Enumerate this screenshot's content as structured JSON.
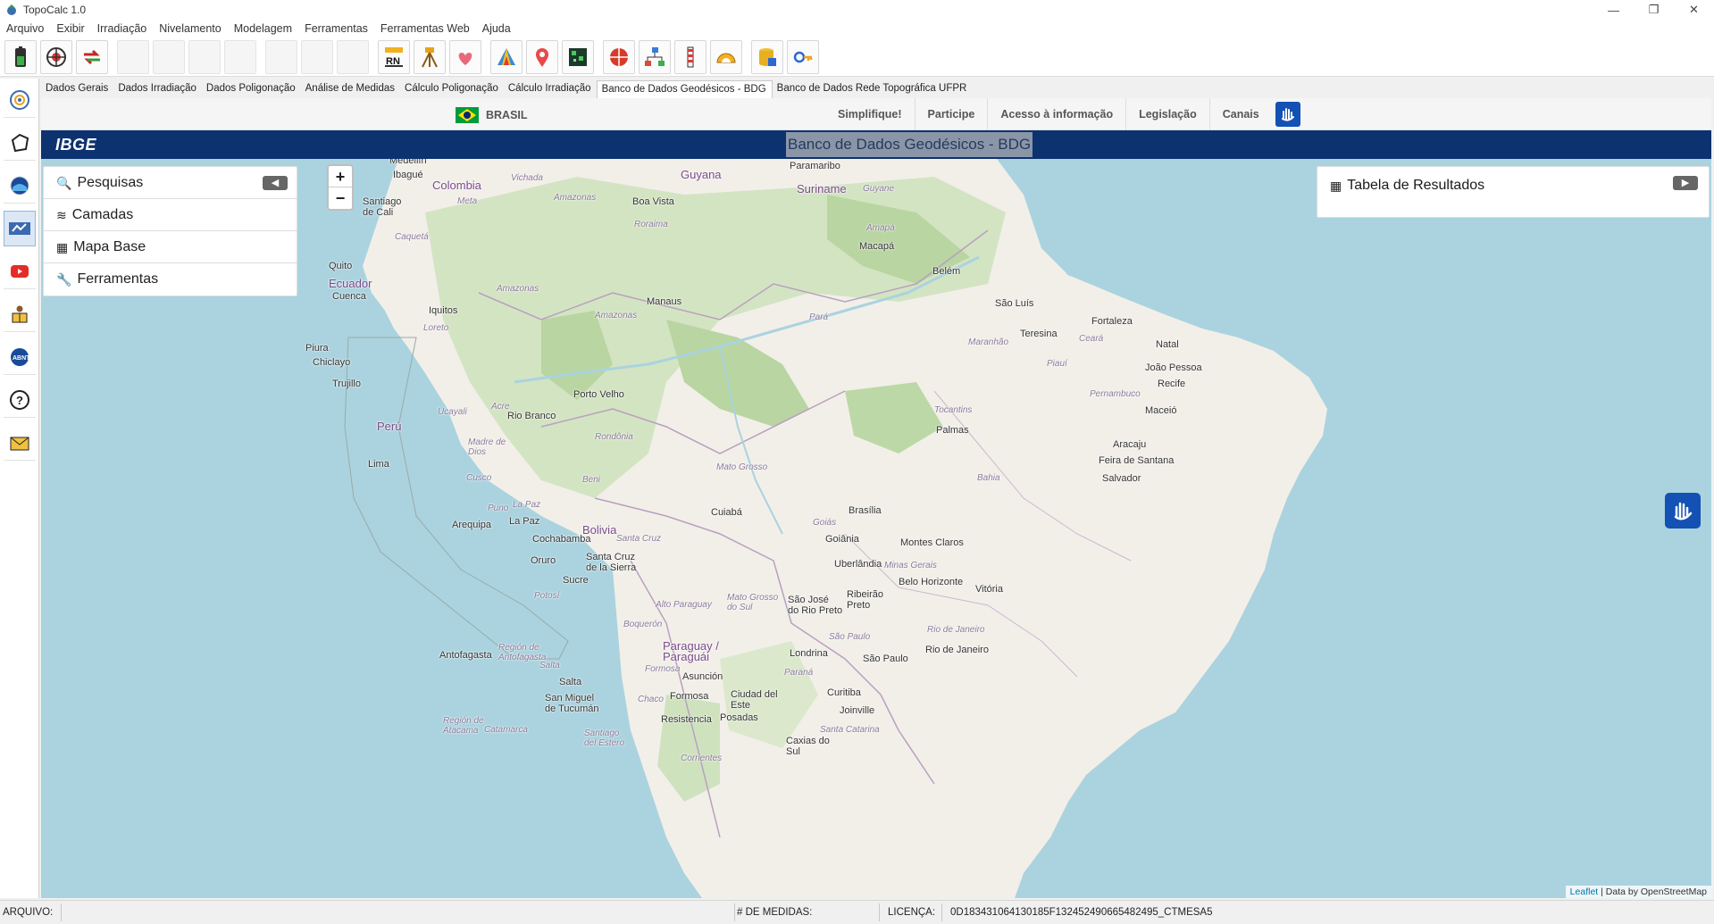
{
  "window": {
    "title": "TopoCalc 1.0",
    "controls": [
      "—",
      "❐",
      "✕"
    ]
  },
  "menu": [
    "Arquivo",
    "Exibir",
    "Irradiação",
    "Nivelamento",
    "Modelagem",
    "Ferramentas",
    "Ferramentas Web",
    "Ajuda"
  ],
  "tabs": [
    "Dados Gerais",
    "Dados Irradiação",
    "Dados Poligonação",
    "Análise de Medidas",
    "Cálculo Poligonação",
    "Cálculo Irradiação",
    "Banco de Dados Geodésicos - BDG",
    "Banco de Dados Rede Topográfica UFPR"
  ],
  "active_tab": "Banco de Dados Geodésicos - BDG",
  "gov_bar": {
    "country": "BRASIL",
    "links": [
      "Simplifique!",
      "Participe",
      "Acesso à informação",
      "Legislação",
      "Canais"
    ]
  },
  "ibge": {
    "logo": "IBGE",
    "title": "Banco de Dados Geodésicos - BDG"
  },
  "map": {
    "zoom_in": "+",
    "zoom_out": "−",
    "panels": [
      {
        "icon": "search-icon",
        "label": "Pesquisas"
      },
      {
        "icon": "layers-icon",
        "label": "Camadas"
      },
      {
        "icon": "map-icon",
        "label": "Mapa Base"
      },
      {
        "icon": "wrench-icon",
        "label": "Ferramentas"
      }
    ],
    "results_title": "Tabela de Resultados",
    "attribution_link": "Leaflet",
    "attribution_text": " | Data by OpenStreetMap",
    "labels": {
      "medellin": "Medellín",
      "vichada": "Vichada",
      "guyana": "Guyana",
      "paramaribo": "Paramaribo",
      "colombia": "Colombia",
      "ibague": "Ibagué",
      "suriname": "Suriname",
      "guyane": "Guyane",
      "meta": "Meta",
      "amazonas1": "Amazonas",
      "boavista": "Boa Vista",
      "cali": "Santiago\nde Cali",
      "roraima": "Roraima",
      "amapa": "Amapá",
      "caqueta": "Caquetá",
      "macapa": "Macapá",
      "quito": "Quito",
      "belem": "Belém",
      "ecuador": "Ecuador",
      "cuenca": "Cuenca",
      "amazonas2": "Amazonas",
      "manaus": "Manaus",
      "saoluis": "São Luís",
      "iquitos": "Iquitos",
      "para": "Pará",
      "fortaleza": "Fortaleza",
      "loreto": "Loreto",
      "amazonas3": "Amazonas",
      "teresina": "Teresina",
      "ceara": "Ceará",
      "piura": "Piura",
      "maranhao": "Maranhão",
      "natal": "Natal",
      "chiclayo": "Chiclayo",
      "piaui": "Piauí",
      "joaopessoa": "João Pessoa",
      "trujillo": "Trujillo",
      "recife": "Recife",
      "portovelho": "Porto Velho",
      "pernambuco": "Pernambuco",
      "maceio": "Maceió",
      "acre": "Acre",
      "ucayali": "Ucayali",
      "riobranco": "Rio Branco",
      "tocantins": "Tocantins",
      "peru": "Perú",
      "palmas": "Palmas",
      "rondonia": "Rondônia",
      "madrededios": "Madre de\nDios",
      "aracaju": "Aracaju",
      "lima": "Lima",
      "matogrosso": "Mato Grosso",
      "feira": "Feira de Santana",
      "bahia": "Bahia",
      "salvador": "Salvador",
      "cusco": "Cusco",
      "beni": "Beni",
      "lapaz1": "La Paz",
      "puno": "Puno",
      "cuiaba": "Cuiabá",
      "brasilia": "Brasília",
      "lapaz2": "La Paz",
      "arequipa": "Arequipa",
      "bolivia": "Bolivia",
      "goias": "Goiás",
      "cochabamba": "Cochabamba",
      "santacruz1": "Santa Cruz",
      "goiania": "Goiânia",
      "montesclaros": "Montes Claros",
      "oruro": "Oruro",
      "santacruz2": "Santa Cruz\nde la Sierra",
      "uberlandia": "Uberlândia",
      "minasgerais": "Minas Gerais",
      "sucre": "Sucre",
      "belohorizonte": "Belo Horizonte",
      "potosi": "Potosí",
      "matogrossosul": "Mato Grosso\ndo Sul",
      "saojose": "São José\ndo Rio Preto",
      "ribeirao": "Ribeirão\nPreto",
      "vitoria": "Vitória",
      "altoparaguay": "Alto Paraguay",
      "boqueron": "Boquerón",
      "saopaulo1": "São Paulo",
      "riodejaneiro1": "Rio de Janeiro",
      "paraguay": "Paraguay /\nParaguái",
      "antofagasta": "Antofagasta",
      "regionantofagasta": "Región de\nAntofagasta",
      "londrina": "Londrina",
      "saopaulo2": "São Paulo",
      "riodejaneiro2": "Rio de Janeiro",
      "salta1": "Salta",
      "formosa1": "Formosa",
      "asuncion": "Asunción",
      "parana": "Paraná",
      "salta2": "Salta",
      "chaco": "Chaco",
      "formosa2": "Formosa",
      "ciudaddeleste": "Ciudad del\nEste",
      "curitiba": "Curitiba",
      "sanmiguel": "San Miguel\nde Tucumán",
      "resistencia": "Resistencia",
      "posadas": "Posadas",
      "joinville": "Joinville",
      "regionatacama": "Región de\nAtacama",
      "catamarca": "Catamarca",
      "santiagodelestero": "Santiago\ndel Estero",
      "santacatarina": "Santa Catarina",
      "caxias": "Caxias do\nSul",
      "corrientes": "Corrientes"
    }
  },
  "status": {
    "arquivo_label": "ARQUIVO:",
    "medidas_label": "# DE MEDIDAS:",
    "licenca_label": "LICENÇA:",
    "licenca_value": "0D183431064130185F132452490665482495_CTMESA5"
  }
}
